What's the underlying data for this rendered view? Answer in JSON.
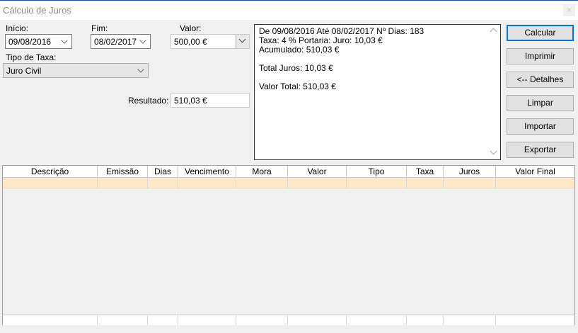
{
  "window": {
    "title": "Cálculo de Juros",
    "close_glyph": "×"
  },
  "form": {
    "inicio": {
      "label": "Início:",
      "value": "09/08/2016"
    },
    "fim": {
      "label": "Fim:",
      "value": "08/02/2017"
    },
    "valor": {
      "label": "Valor:",
      "value": "500,00 €"
    },
    "tipo_taxa": {
      "label": "Tipo de Taxa:",
      "value": "Juro Civil"
    },
    "resultado": {
      "label": "Resultado:",
      "value": "510,03 €"
    }
  },
  "details": {
    "lines": [
      "De 09/08/2016   Até  08/02/2017 Nº Dias: 183",
      "Taxa: 4 %  Portaria:   Juro: 10,03 €",
      "Acumulado: 510,03 €",
      "Total Juros: 10,03 €",
      "Valor Total: 510,03 €"
    ]
  },
  "buttons": {
    "calcular": "Calcular",
    "imprimir": "Imprimir",
    "detalhes": "<-- Detalhes",
    "limpar": "Limpar",
    "importar": "Importar",
    "exportar": "Exportar"
  },
  "table": {
    "columns": [
      "Descrição",
      "Emissão",
      "Dias",
      "Vencimento",
      "Mora",
      "Valor",
      "Tipo",
      "Taxa",
      "Juros",
      "Valor Final"
    ],
    "row_highlight_color": "#fde8c8"
  },
  "colors": {
    "accent": "#0078d7",
    "titlebar_border": "#1c4f9c"
  }
}
